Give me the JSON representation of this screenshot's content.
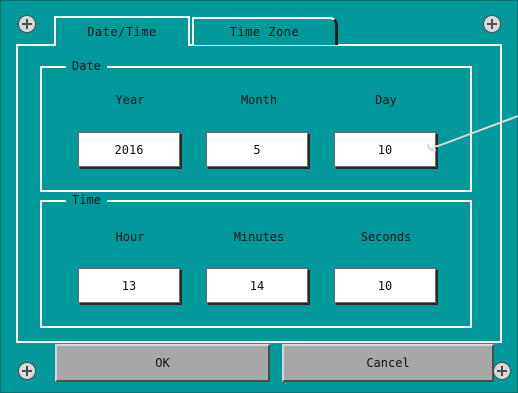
{
  "tabs": [
    {
      "label": "Date/Time",
      "active": true
    },
    {
      "label": "Time Zone",
      "active": false
    }
  ],
  "date_group": {
    "title": "Date",
    "fields": [
      {
        "label": "Year",
        "value": "2016"
      },
      {
        "label": "Month",
        "value": "5"
      },
      {
        "label": "Day",
        "value": "10"
      }
    ]
  },
  "time_group": {
    "title": "Time",
    "fields": [
      {
        "label": "Hour",
        "value": "13"
      },
      {
        "label": "Minutes",
        "value": "14"
      },
      {
        "label": "Seconds",
        "value": "10"
      }
    ]
  },
  "buttons": {
    "ok": "OK",
    "cancel": "Cancel"
  },
  "colors": {
    "screen_background": "#00999b",
    "field_background": "#ffffff",
    "button_background": "#a7a7a7"
  }
}
